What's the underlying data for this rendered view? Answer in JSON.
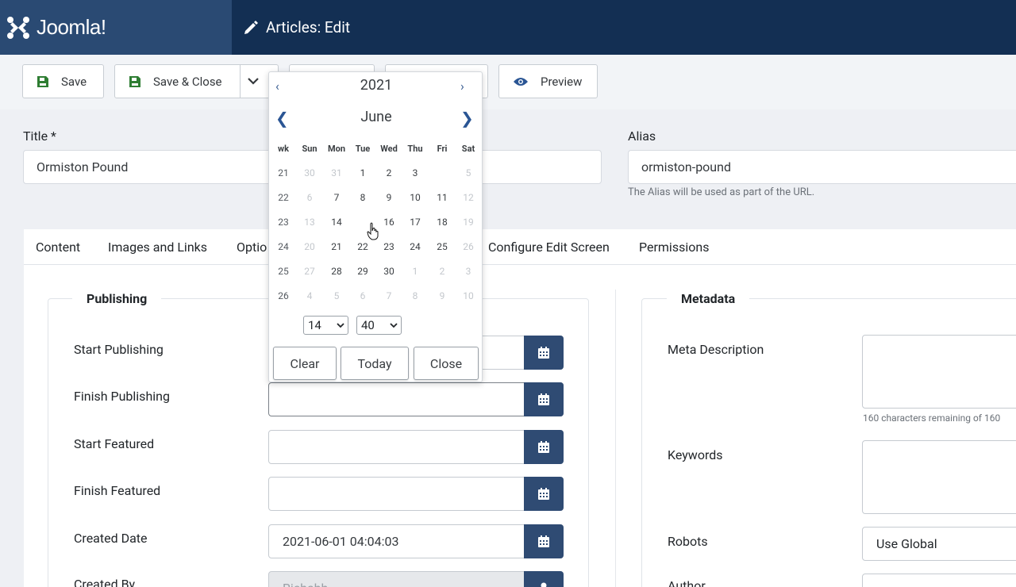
{
  "header": {
    "logo_text": "Joomla!",
    "page_title": "Articles: Edit"
  },
  "toolbar": {
    "save": "Save",
    "save_close": "Save & Close",
    "preview": "Preview"
  },
  "form": {
    "title_label": "Title *",
    "title_value": "Ormiston Pound",
    "alias_label": "Alias",
    "alias_value": "ormiston-pound",
    "alias_hint": "The Alias will be used as part of the URL."
  },
  "tabs": [
    "Content",
    "Images and Links",
    "Optio",
    "Configure Edit Screen",
    "Permissions"
  ],
  "publishing": {
    "legend": "Publishing",
    "rows": [
      {
        "label": "Start Publishing",
        "value": ""
      },
      {
        "label": "Finish Publishing",
        "value": ""
      },
      {
        "label": "Start Featured",
        "value": ""
      },
      {
        "label": "Finish Featured",
        "value": ""
      },
      {
        "label": "Created Date",
        "value": "2021-06-01 04:04:03"
      },
      {
        "label": "Created By",
        "value": "Richahh"
      }
    ]
  },
  "metadata": {
    "legend": "Metadata",
    "meta_description_label": "Meta Description",
    "meta_description_hint": "160 characters remaining of 160",
    "keywords_label": "Keywords",
    "robots_label": "Robots",
    "robots_value": "Use Global",
    "author_label": "Author"
  },
  "calendar": {
    "year": "2021",
    "month": "June",
    "prev_year": "‹",
    "next_year": "›",
    "prev_month": "❮",
    "next_month": "❯",
    "headers": [
      "wk",
      "Sun",
      "Mon",
      "Tue",
      "Wed",
      "Thu",
      "Fri",
      "Sat"
    ],
    "weeks": [
      [
        "21",
        "30",
        "31",
        "1",
        "2",
        "3",
        "",
        "5"
      ],
      [
        "22",
        "6",
        "7",
        "8",
        "9",
        "10",
        "11",
        "12"
      ],
      [
        "23",
        "13",
        "14",
        "",
        "16",
        "17",
        "18",
        "19"
      ],
      [
        "24",
        "20",
        "21",
        "22",
        "23",
        "24",
        "25",
        "26"
      ],
      [
        "25",
        "27",
        "28",
        "29",
        "30",
        "1",
        "2",
        "3"
      ],
      [
        "26",
        "4",
        "5",
        "6",
        "7",
        "8",
        "9",
        "10"
      ]
    ],
    "hour": "14",
    "minute": "40",
    "clear": "Clear",
    "today": "Today",
    "close": "Close"
  },
  "colors": {
    "header_bg": "#132f53",
    "logo_bg": "#2a4a73",
    "accent": "#2f4b73"
  }
}
